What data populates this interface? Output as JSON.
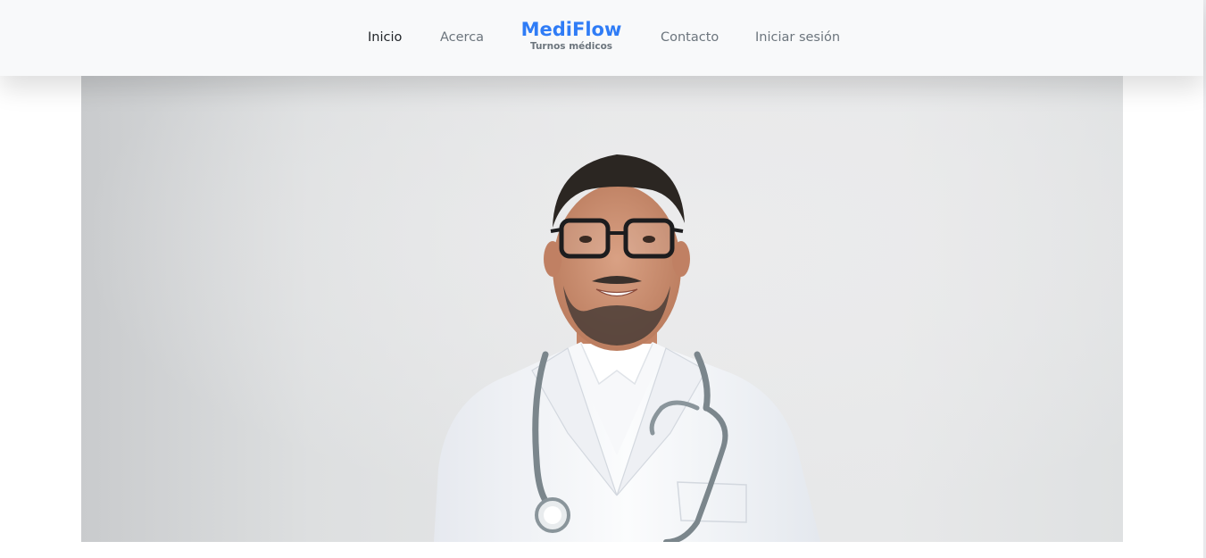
{
  "nav": {
    "left": [
      {
        "label": "Inicio"
      },
      {
        "label": "Acerca"
      }
    ],
    "brand": {
      "name": "MediFlow",
      "tagline": "Turnos médicos"
    },
    "right": [
      {
        "label": "Contacto"
      },
      {
        "label": "Iniciar sesión"
      }
    ],
    "active": "Inicio"
  },
  "hero": {
    "image": "doctor-portrait",
    "subject": "smiling doctor in white coat with stethoscope and glasses"
  },
  "colors": {
    "brand": "#2f7cf6",
    "navbar_bg": "#f8f9fa",
    "nav_text": "#6c757d",
    "nav_active": "#212529"
  }
}
